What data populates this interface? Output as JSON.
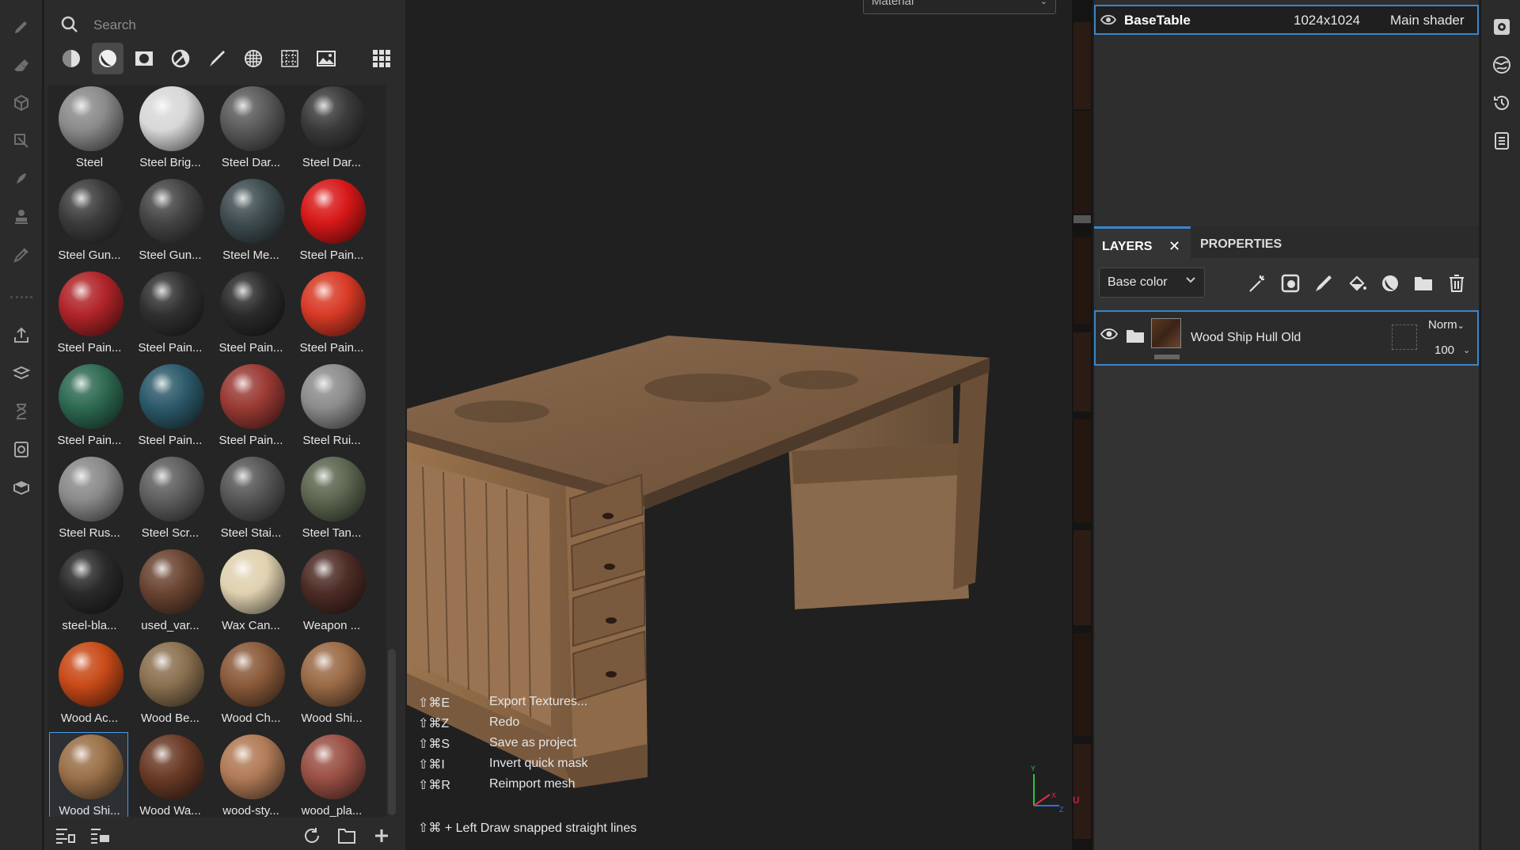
{
  "search": {
    "placeholder": "Search",
    "value": ""
  },
  "filters": [
    "all-materials-icon",
    "smart-materials-icon",
    "smart-masks-icon",
    "filters-icon",
    "brushes-icon",
    "alphas-icon",
    "procedurals-icon",
    "textures-icon",
    "grid-view-icon"
  ],
  "materials": [
    {
      "label": "Steel",
      "color": "#8a8a8a"
    },
    {
      "label": "Steel Brig...",
      "color": "#d8d8d8"
    },
    {
      "label": "Steel Dar...",
      "color": "#5a5a5a"
    },
    {
      "label": "Steel Dar...",
      "color": "#3a3a3a"
    },
    {
      "label": "Steel Gun...",
      "color": "#3c3c3c"
    },
    {
      "label": "Steel Gun...",
      "color": "#444444"
    },
    {
      "label": "Steel Me...",
      "color": "#3f4d50"
    },
    {
      "label": "Steel Pain...",
      "color": "#d81818"
    },
    {
      "label": "Steel Pain...",
      "color": "#b02428"
    },
    {
      "label": "Steel Pain...",
      "color": "#303030"
    },
    {
      "label": "Steel Pain...",
      "color": "#2a2a2a"
    },
    {
      "label": "Steel Pain...",
      "color": "#d83a26"
    },
    {
      "label": "Steel Pain...",
      "color": "#2e6a52"
    },
    {
      "label": "Steel Pain...",
      "color": "#2c5a6a"
    },
    {
      "label": "Steel Pain...",
      "color": "#9a3a34"
    },
    {
      "label": "Steel Rui...",
      "color": "#8c8c8c"
    },
    {
      "label": "Steel Rus...",
      "color": "#8a8a8a"
    },
    {
      "label": "Steel Scr...",
      "color": "#5e5e5e"
    },
    {
      "label": "Steel Stai...",
      "color": "#565656"
    },
    {
      "label": "Steel Tan...",
      "color": "#5c6650"
    },
    {
      "label": "steel-bla...",
      "color": "#2a2a2a"
    },
    {
      "label": "used_var...",
      "color": "#6a4432"
    },
    {
      "label": "Wax Can...",
      "color": "#e0d2b0"
    },
    {
      "label": "Weapon ...",
      "color": "#4e2c26"
    },
    {
      "label": "Wood Ac...",
      "color": "#c84a18"
    },
    {
      "label": "Wood Be...",
      "color": "#8a7050"
    },
    {
      "label": "Wood Ch...",
      "color": "#8a5a3a"
    },
    {
      "label": "Wood Shi...",
      "color": "#9a6a46"
    },
    {
      "label": "Wood Shi...",
      "color": "#9a7048"
    },
    {
      "label": "Wood Wa...",
      "color": "#6a3a26"
    },
    {
      "label": "wood-sty...",
      "color": "#b07a56"
    },
    {
      "label": "wood_pla...",
      "color": "#9a5044"
    }
  ],
  "selected_material_index": 28,
  "viewport": {
    "shader_dropdown": "Material",
    "shortcuts": [
      {
        "keys": "⇧⌘E",
        "action": "Export Textures..."
      },
      {
        "keys": "⇧⌘Z",
        "action": "Redo"
      },
      {
        "keys": "⇧⌘S",
        "action": "Save as project"
      },
      {
        "keys": "⇧⌘I",
        "action": "Invert quick mask"
      },
      {
        "keys": "⇧⌘R",
        "action": "Reimport mesh"
      }
    ],
    "snap_hint": "⇧⌘ + Left  Draw snapped straight lines",
    "axis_labels": {
      "x": "X",
      "y": "Y",
      "z": "Z"
    },
    "uv_marker": "U"
  },
  "texture_set": {
    "name": "BaseTable",
    "resolution": "1024x1024",
    "shader": "Main shader"
  },
  "layers_panel": {
    "tab_layers": "LAYERS",
    "tab_properties": "PROPERTIES",
    "channel": "Base color",
    "layers": [
      {
        "name": "Wood Ship Hull Old",
        "blend": "Norm",
        "opacity": "100"
      }
    ]
  },
  "colors": {
    "accent": "#3a86c9",
    "panel": "#2b2b2b",
    "viewport": "#202020"
  }
}
